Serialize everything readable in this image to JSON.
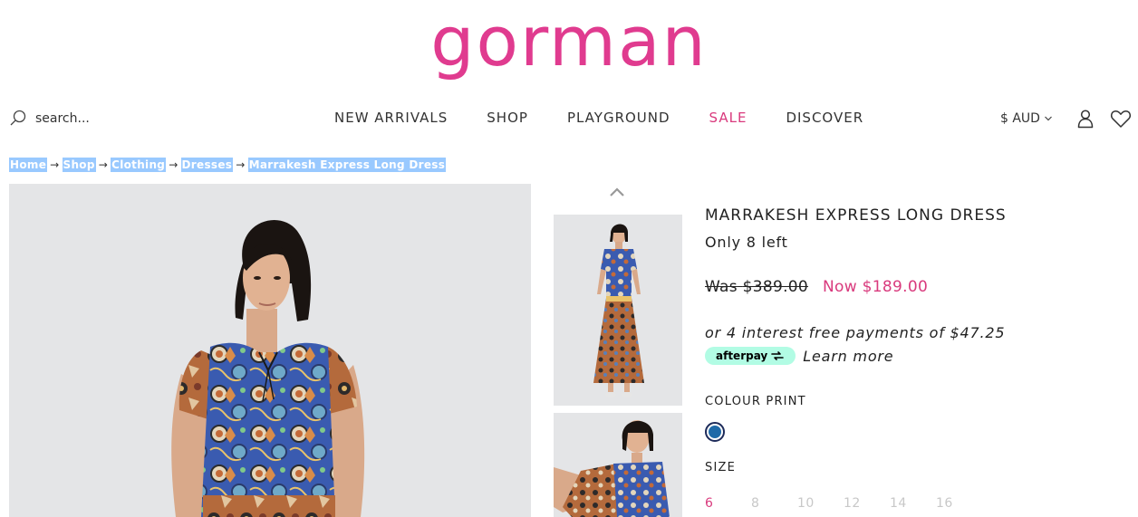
{
  "brand": {
    "logo_text": "gorman",
    "color": "#e03b8f"
  },
  "header": {
    "search_placeholder": "search...",
    "nav": [
      "NEW ARRIVALS",
      "SHOP",
      "PLAYGROUND",
      "SALE",
      "DISCOVER"
    ],
    "sale_color": "#d93a7d",
    "currency": "$ AUD"
  },
  "breadcrumb": [
    "Home",
    "Shop",
    "Clothing",
    "Dresses",
    "Marrakesh Express Long Dress"
  ],
  "product": {
    "title": "MARRAKESH EXPRESS LONG DRESS",
    "stock": "Only 8 left",
    "was_label": "Was",
    "was_price": "$389.00",
    "now_label": "Now",
    "now_price": "$189.00",
    "installments": "or 4 interest free payments of $47.25",
    "afterpay_label": "afterpay",
    "learn_more": "Learn more",
    "colour_label": "COLOUR PRINT",
    "swatch_color": "#1f6aa8",
    "size_label": "SIZE",
    "sizes": [
      "6",
      "8",
      "10",
      "12",
      "14",
      "16"
    ],
    "selected_size": "6"
  },
  "icons": {
    "search": "search-icon",
    "user": "user-icon",
    "heart": "heart-icon",
    "chevron_down": "chevron-down-icon",
    "chevron_up": "chevron-up-icon"
  }
}
